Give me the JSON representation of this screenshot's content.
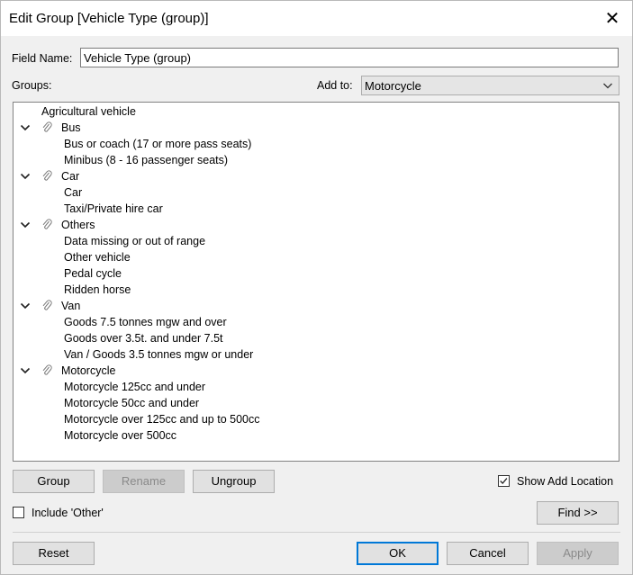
{
  "window": {
    "title": "Edit Group [Vehicle Type (group)]",
    "close_glyph": "✕"
  },
  "field_name": {
    "label": "Field Name:",
    "value": "Vehicle Type (group)"
  },
  "groups_label": "Groups:",
  "add_to": {
    "label": "Add to:",
    "value": "Motorcycle"
  },
  "tree": {
    "ungrouped": "Agricultural vehicle",
    "groups": [
      {
        "name": "Bus",
        "items": [
          "Bus or coach (17 or more pass seats)",
          "Minibus (8 - 16 passenger seats)"
        ]
      },
      {
        "name": "Car",
        "items": [
          "Car",
          "Taxi/Private hire car"
        ]
      },
      {
        "name": "Others",
        "items": [
          "Data missing or out of range",
          "Other vehicle",
          "Pedal cycle",
          "Ridden horse"
        ]
      },
      {
        "name": "Van",
        "items": [
          "Goods 7.5 tonnes mgw and over",
          "Goods over 3.5t. and under 7.5t",
          "Van / Goods 3.5 tonnes mgw or under"
        ]
      },
      {
        "name": "Motorcycle",
        "items": [
          "Motorcycle 125cc and under",
          "Motorcycle 50cc and under",
          "Motorcycle over 125cc and up to 500cc",
          "Motorcycle over 500cc"
        ]
      }
    ]
  },
  "buttons": {
    "group": "Group",
    "rename": "Rename",
    "ungroup": "Ungroup",
    "find": "Find >>",
    "reset": "Reset",
    "ok": "OK",
    "cancel": "Cancel",
    "apply": "Apply"
  },
  "checkboxes": {
    "show_add_location": {
      "label": "Show Add Location",
      "checked": true
    },
    "include_other": {
      "label": "Include 'Other'",
      "checked": false
    }
  },
  "icons": {
    "expand": "chevron-down-icon",
    "group": "paperclip-icon",
    "close": "close-icon",
    "dropdown": "chevron-down-icon"
  }
}
